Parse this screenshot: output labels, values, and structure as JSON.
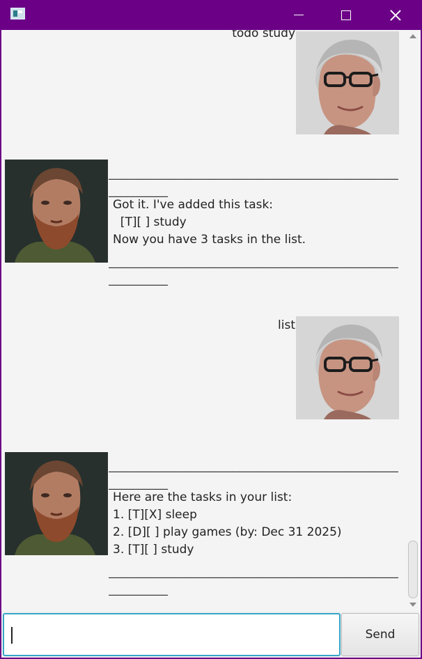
{
  "window": {
    "title_icon": "app-icon",
    "controls": {
      "minimize": "minimize-icon",
      "maximize": "maximize-icon",
      "close": "close-icon"
    }
  },
  "chat": {
    "messages": [
      {
        "sender": "user",
        "lines": [
          "todo study"
        ],
        "avatar": "user-avatar-older-man-glasses"
      },
      {
        "sender": "bot",
        "rule_top": "______________________________________________________",
        "rule_top2": "__________",
        "lines": [
          "Got it. I've added this task:",
          "  [T][ ] study",
          "Now you have 3 tasks in the list."
        ],
        "rule_bottom": "______________________________________________________",
        "rule_bottom2": "__________",
        "avatar": "bot-avatar-bearded-man"
      },
      {
        "sender": "user",
        "lines": [
          "list"
        ],
        "avatar": "user-avatar-older-man-glasses"
      },
      {
        "sender": "bot",
        "rule_top": "______________________________________________________",
        "rule_top2": "__________",
        "lines": [
          "Here are the tasks in your list:",
          "1. [T][X] sleep",
          "2. [D][ ] play games (by: Dec 31 2025)",
          "3. [T][ ] study"
        ],
        "rule_bottom": "______________________________________________________",
        "rule_bottom2": "__________",
        "avatar": "bot-avatar-bearded-man"
      }
    ]
  },
  "input": {
    "value": "",
    "placeholder": ""
  },
  "send_button": {
    "label": "Send"
  },
  "colors": {
    "titlebar": "#6b0086",
    "background": "#f4f4f4",
    "input_focus": "#37a5c8"
  }
}
